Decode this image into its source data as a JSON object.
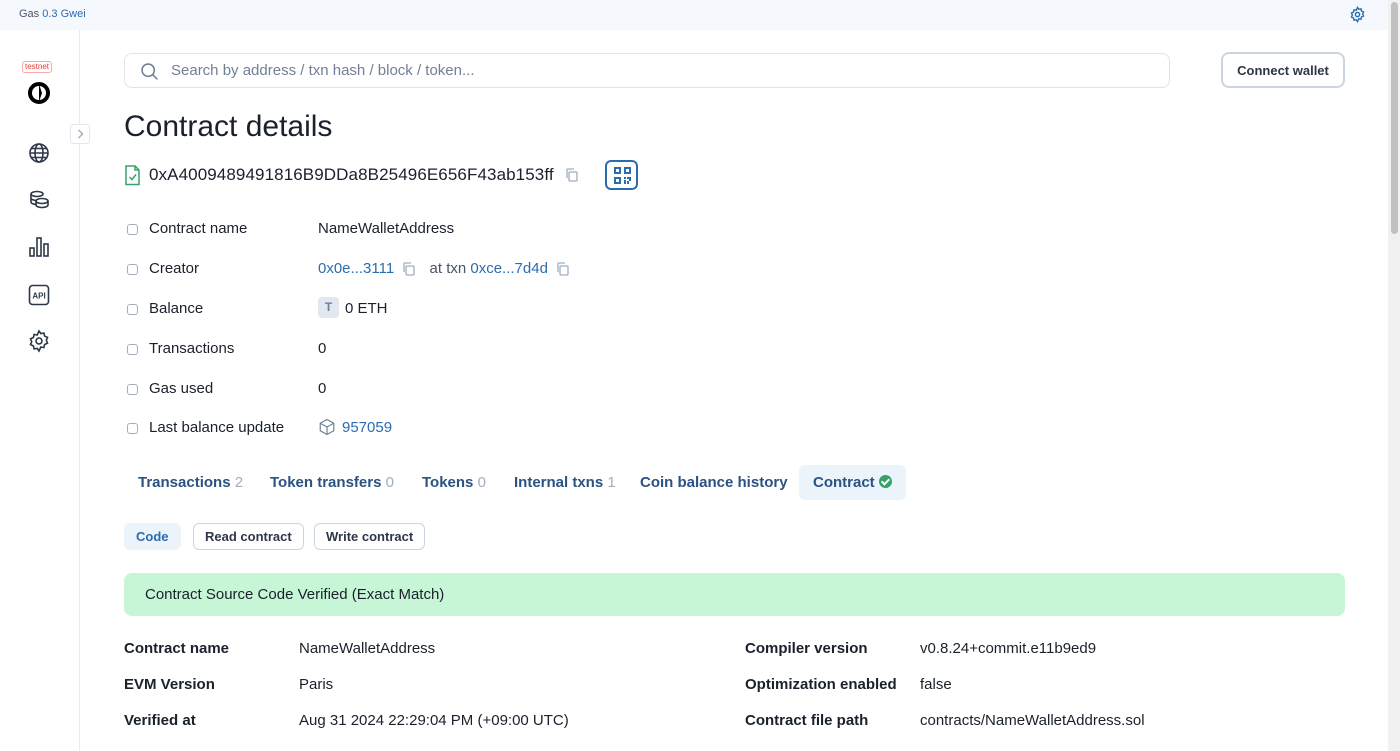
{
  "topbar": {
    "gas_label": "Gas",
    "gas_value": "0.3 Gwei"
  },
  "sidebar": {
    "testnet_badge": "testnet"
  },
  "search": {
    "placeholder": "Search by address / txn hash / block / token..."
  },
  "header": {
    "connect_label": "Connect wallet"
  },
  "page": {
    "title": "Contract details"
  },
  "contract": {
    "address": "0xA4009489491816B9DDa8B25496E656F43ab153ff",
    "rows": {
      "name": {
        "label": "Contract name",
        "value": "NameWalletAddress"
      },
      "creator": {
        "label": "Creator",
        "address": "0x0e...3111",
        "at_txn": "at txn",
        "txn": "0xce...7d4d"
      },
      "balance": {
        "label": "Balance",
        "badge": "T",
        "value": "0 ETH"
      },
      "transactions": {
        "label": "Transactions",
        "value": "0"
      },
      "gas_used": {
        "label": "Gas used",
        "value": "0"
      },
      "last_update": {
        "label": "Last balance update",
        "value": "957059"
      }
    }
  },
  "tabs": [
    {
      "label": "Transactions",
      "count": "2"
    },
    {
      "label": "Token transfers",
      "count": "0"
    },
    {
      "label": "Tokens",
      "count": "0"
    },
    {
      "label": "Internal txns",
      "count": "1"
    },
    {
      "label": "Coin balance history",
      "count": ""
    },
    {
      "label": "Contract",
      "count": ""
    }
  ],
  "subtabs": [
    "Code",
    "Read contract",
    "Write contract"
  ],
  "verified_banner": "Contract Source Code Verified (Exact Match)",
  "details": {
    "left": [
      {
        "label": "Contract name",
        "value": "NameWalletAddress"
      },
      {
        "label": "EVM Version",
        "value": "Paris"
      },
      {
        "label": "Verified at",
        "value": "Aug 31 2024 22:29:04 PM (+09:00 UTC)"
      }
    ],
    "right": [
      {
        "label": "Compiler version",
        "value": "v0.8.24+commit.e11b9ed9"
      },
      {
        "label": "Optimization enabled",
        "value": "false"
      },
      {
        "label": "Contract file path",
        "value": "contracts/NameWalletAddress.sol"
      }
    ]
  },
  "colors": {
    "link": "#2b6cb0",
    "verified_bg": "#c6f6d5",
    "tab_active_bg": "#ebf4fb"
  }
}
